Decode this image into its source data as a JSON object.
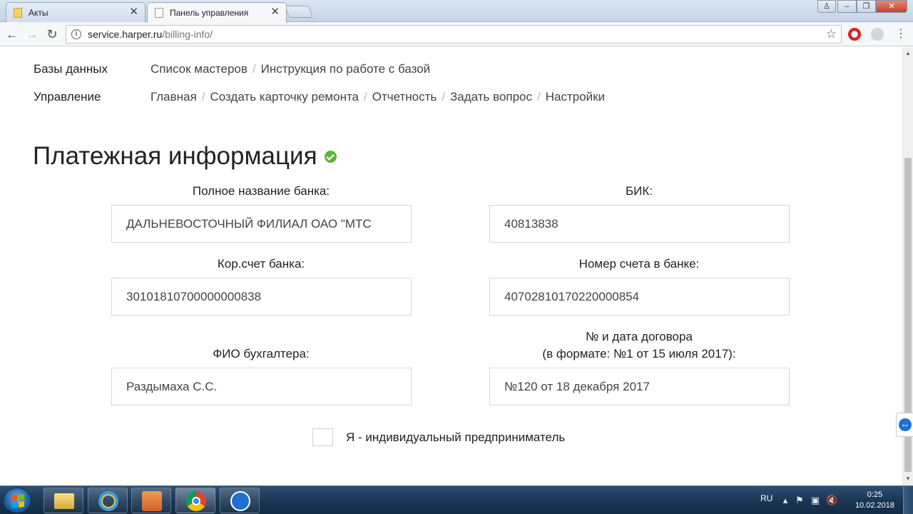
{
  "browser": {
    "tabs": [
      {
        "title": "Акты",
        "active": false
      },
      {
        "title": "Панель управления",
        "active": true
      }
    ],
    "url_host": "service.harper.ru",
    "url_path": "/billing-info/"
  },
  "nav": {
    "databases_label": "Базы данных",
    "databases_links": [
      "Список мастеров",
      "Инструкция по работе с базой"
    ],
    "management_label": "Управление",
    "management_links": [
      "Главная",
      "Создать карточку ремонта",
      "Отчетность",
      "Задать вопрос",
      "Настройки"
    ],
    "separator": "/"
  },
  "page_title": "Платежная информация",
  "form": {
    "bank_name": {
      "label": "Полное название банка:",
      "value": "ДАЛЬНЕВОСТОЧНЫЙ ФИЛИАЛ ОАО \"МТС"
    },
    "bik": {
      "label": "БИК:",
      "value": "40813838"
    },
    "corr_account": {
      "label": "Кор.счет банка:",
      "value": "30101810700000000838"
    },
    "account_number": {
      "label": "Номер счета в банке:",
      "value": "40702810170220000854"
    },
    "accountant": {
      "label": "ФИО бухгалтера:",
      "value": "Раздымаха С.С."
    },
    "contract": {
      "label_line1": "№ и дата договора",
      "label_line2": "(в формате: №1 от 15 июля 2017):",
      "value": "№120 от 18 декабря 2017"
    },
    "entrepreneur_checkbox": {
      "label": "Я - индивидуальный предприниматель",
      "checked": false
    }
  },
  "taskbar": {
    "language": "RU",
    "time": "0:25",
    "date": "10.02.2018"
  },
  "colors": {
    "check_green": "#63b13f",
    "taskbar": "#1b3755"
  }
}
